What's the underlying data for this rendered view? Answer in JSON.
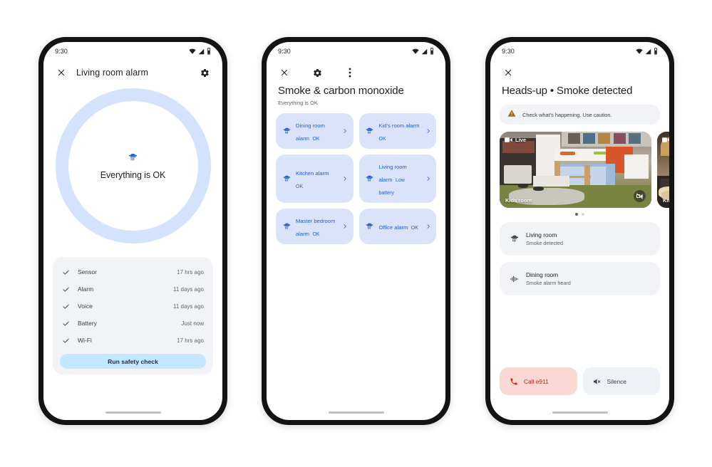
{
  "phone1": {
    "statusbar": {
      "time": "9:30"
    },
    "topbar": {
      "close": "✕",
      "title": "Living room alarm",
      "settings": "gear-icon"
    },
    "status_ring": {
      "icon": "smoke-detector-icon",
      "label": "Everything is OK"
    },
    "checks": [
      {
        "name": "Sensor",
        "time": "17 hrs ago"
      },
      {
        "name": "Alarm",
        "time": "11 days ago"
      },
      {
        "name": "Voice",
        "time": "11 days ago"
      },
      {
        "name": "Battery",
        "time": "Just now"
      },
      {
        "name": "Wi-Fi",
        "time": "17 hrs ago"
      }
    ],
    "safety_button": "Run safety check"
  },
  "phone2": {
    "statusbar": {
      "time": "9:30"
    },
    "topbar": {
      "close": "✕",
      "settings": "gear-icon",
      "overflow": "more-vert-icon"
    },
    "title": "Smoke & carbon monoxide",
    "subtitle": "Everything is OK",
    "tiles": [
      {
        "name": "Dining room alarm",
        "state": "OK"
      },
      {
        "name": "Kid’s room alarm",
        "state": "OK"
      },
      {
        "name": "Kitchen alarm",
        "state": "OK"
      },
      {
        "name": "Living room alarm",
        "state": "Low battery"
      },
      {
        "name": "Master bedroom alarm",
        "state": "OK"
      },
      {
        "name": "Office alarm",
        "state": "OK"
      }
    ]
  },
  "phone3": {
    "statusbar": {
      "time": "9:30"
    },
    "topbar": {
      "close": "✕"
    },
    "title": "Heads-up • Smoke detected",
    "banner": {
      "icon": "warning-icon",
      "text": "Check what’s happening. Use caution."
    },
    "cameras": [
      {
        "label": "Kids room",
        "live": "Live"
      },
      {
        "label": "Kitch"
      }
    ],
    "page_dots": {
      "count": 2,
      "active": 0
    },
    "events": [
      {
        "name": "Living room",
        "detail": "Smoke detected",
        "icon": "smoke-detector-icon"
      },
      {
        "name": "Dining room",
        "detail": "Smoke alarm heard",
        "icon": "sound-wave-icon"
      }
    ],
    "actions": [
      {
        "label": "Call e911",
        "icon": "phone-icon"
      },
      {
        "label": "Silence",
        "icon": "volume-off-icon"
      }
    ]
  },
  "colors": {
    "accent_blue": "#2260d3",
    "ring_blue": "#d3e3fd",
    "tile_blue": "#dbe3fb",
    "button_blue": "#c2e7ff",
    "card_gray": "#f1f3f6",
    "danger_bg": "#fad9d4",
    "danger_text": "#c5221f",
    "warning_amber": "#a36718"
  }
}
